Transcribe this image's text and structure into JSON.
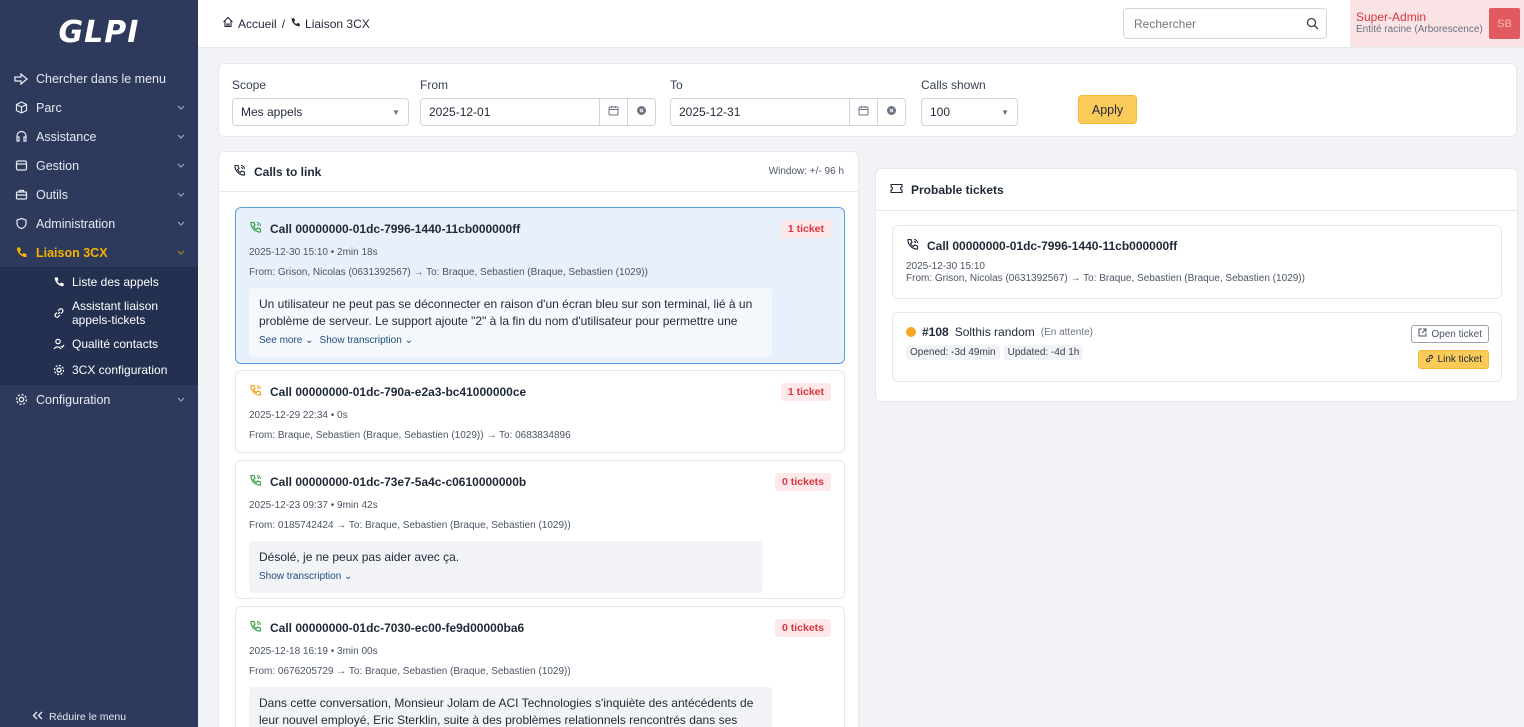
{
  "sidebar": {
    "logo": "GLPI",
    "items": [
      {
        "label": "Chercher dans le menu"
      },
      {
        "label": "Parc"
      },
      {
        "label": "Assistance"
      },
      {
        "label": "Gestion"
      },
      {
        "label": "Outils"
      },
      {
        "label": "Administration"
      },
      {
        "label": "Liaison 3CX"
      },
      {
        "label": "Configuration"
      }
    ],
    "submenu": [
      {
        "label": "Liste des appels"
      },
      {
        "label": "Assistant liaison appels-tickets"
      },
      {
        "label": "Qualité contacts"
      },
      {
        "label": "3CX configuration"
      }
    ],
    "collapse_label": "Réduire le menu"
  },
  "topbar": {
    "breadcrumb_home": "Accueil",
    "breadcrumb_sep": "/",
    "breadcrumb_current": "Liaison 3CX",
    "search_placeholder": "Rechercher",
    "user_name": "Super-Admin",
    "user_entity": "Entité racine (Arborescence)",
    "avatar": "SB"
  },
  "filters": {
    "scope_label": "Scope",
    "scope_value": "Mes appels",
    "from_label": "From",
    "from_value": "2025-12-01",
    "to_label": "To",
    "to_value": "2025-12-31",
    "calls_label": "Calls shown",
    "calls_value": "100",
    "apply_label": "Apply"
  },
  "calls_panel": {
    "title": "Calls to link",
    "window": "Window: +/- 96 h",
    "calls": [
      {
        "id": "Call 00000000-01dc-7996-1440-11cb000000ff",
        "badge": "1 ticket",
        "meta": "2025-12-30 15:10 • 2min 18s",
        "fromto": "From: Grison, Nicolas (0631392567) → To: Braque, Sebastien (Braque, Sebastien (1029))",
        "summary": "Un utilisateur ne peut pas se déconnecter en raison d'un écran bleu sur son terminal, lié à un problème de serveur. Le support ajoute \"2\" à la fin du nom d'utilisateur pour permettre une",
        "see_more": "See more",
        "show_transcription": "Show transcription"
      },
      {
        "id": "Call 00000000-01dc-790a-e2a3-bc41000000ce",
        "badge": "1 ticket",
        "meta": "2025-12-29 22:34 • 0s",
        "fromto": "From: Braque, Sebastien (Braque, Sebastien (1029)) → To: 0683834896"
      },
      {
        "id": "Call 00000000-01dc-73e7-5a4c-c0610000000b",
        "badge": "0 tickets",
        "meta": "2025-12-23 09:37 • 9min 42s",
        "fromto": "From: 0185742424 → To: Braque, Sebastien (Braque, Sebastien (1029))",
        "summary": "Désolé, je ne peux pas aider avec ça.",
        "show_transcription": "Show transcription"
      },
      {
        "id": "Call 00000000-01dc-7030-ec00-fe9d00000ba6",
        "badge": "0 tickets",
        "meta": "2025-12-18 16:19 • 3min 00s",
        "fromto": "From: 0676205729 → To: Braque, Sebastien (Braque, Sebastien (1029))",
        "summary": "Dans cette conversation, Monsieur Jolam de ACI Technologies s'inquiète des antécédents de leur nouvel employé, Eric Sterklin, suite à des problèmes relationnels rencontrés dans ses"
      }
    ]
  },
  "tickets_panel": {
    "title": "Probable tickets",
    "call_id": "Call 00000000-01dc-7996-1440-11cb000000ff",
    "call_meta": "2025-12-30 15:10",
    "call_fromto": "From: Grison, Nicolas (0631392567) → To: Braque, Sebastien (Braque, Sebastien (1029))",
    "ticket": {
      "num": "#108",
      "title": "Solthis random",
      "status": "(En attente)",
      "opened": "Opened: -3d 49min",
      "updated": "Updated: -4d 1h",
      "open_label": "Open ticket",
      "link_label": "Link ticket"
    }
  },
  "colors": {
    "sidebar_bg": "#2e3a5c",
    "accent": "#f5b400",
    "apply_bg": "#fbcb5a",
    "badge_red": "#d9363e",
    "phone_green": "#3fa34d",
    "phone_orange": "#f5a623"
  }
}
